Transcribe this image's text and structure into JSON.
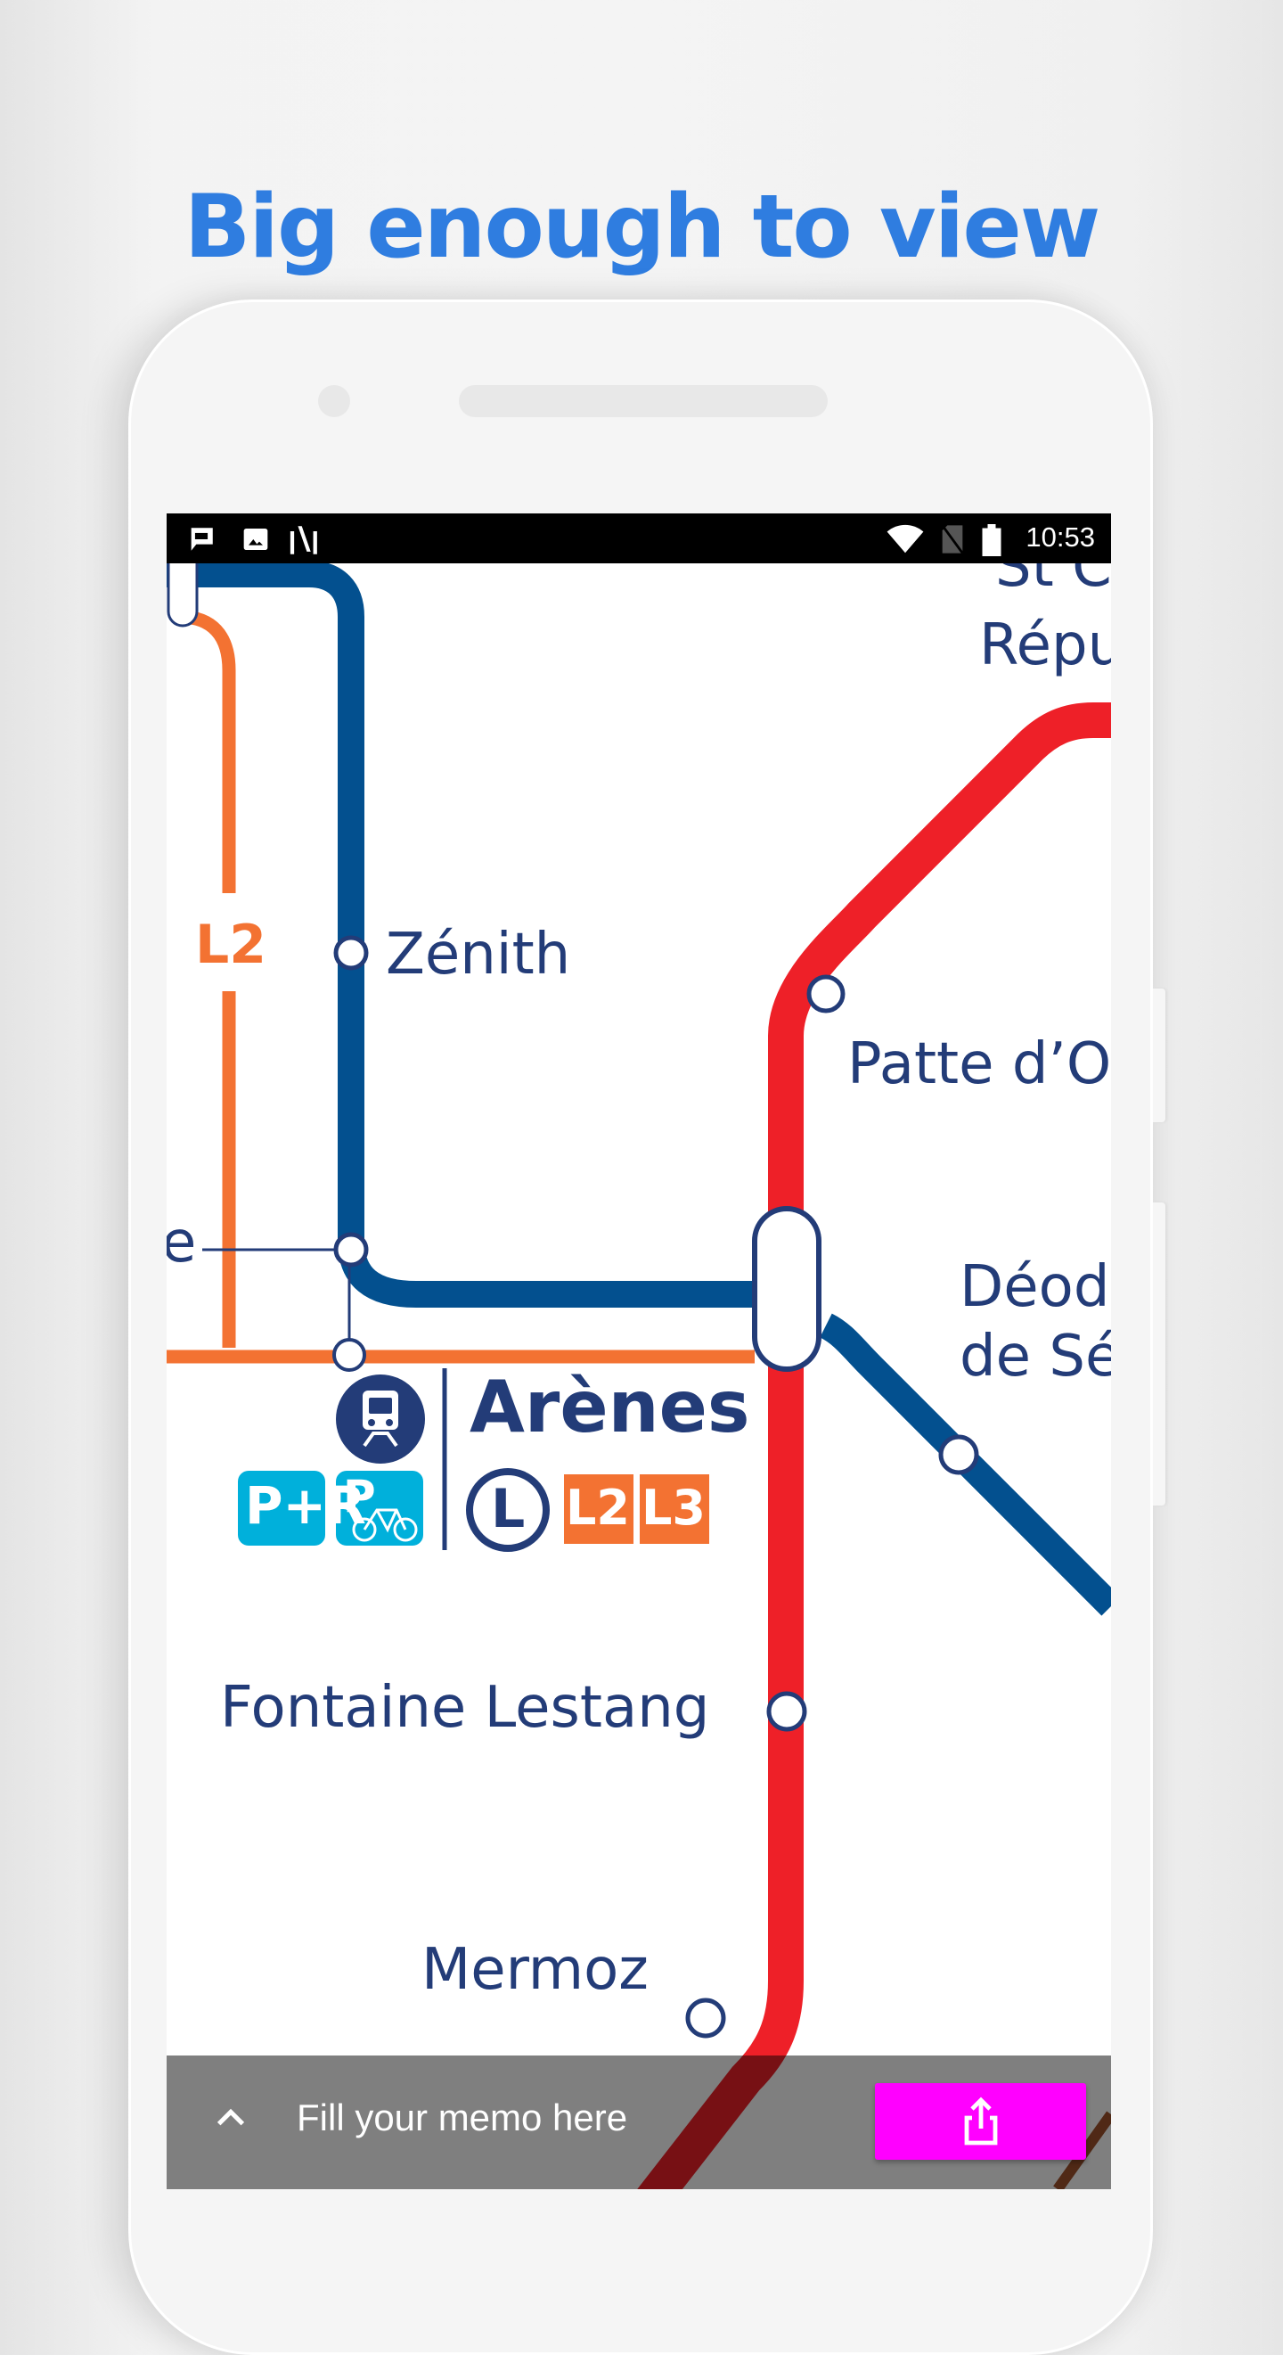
{
  "headline": "Big enough to view",
  "status_bar": {
    "left_icons": [
      "chat-notification-icon",
      "image-notification-icon",
      "app-notification-icon"
    ],
    "right_icons": [
      "wifi-icon",
      "no-sim-icon",
      "battery-icon"
    ],
    "time": "10:53"
  },
  "map": {
    "line_colors": {
      "metro_blue": "#03508f",
      "metro_red": "#ee2028",
      "tram_orange": "#f37232",
      "label_navy": "#233c78",
      "parking_cyan": "#00b0db"
    },
    "stations": {
      "st_charles_line1": "St C",
      "st_charles_line2": "Répu",
      "zenith": "Zénith",
      "patte_doie": "Patte d’O",
      "deodat_line1": "Déod",
      "deodat_line2": "de Sé",
      "partial_left": "e",
      "arenes": "Arènes",
      "fontaine_lestang": "Fontaine Lestang",
      "mermoz": "Mermoz"
    },
    "tram_line_label": "L2",
    "arenes_badges": {
      "park_ride": "P+R",
      "bike_parking": "P",
      "metro_letter": "L",
      "tram_lines": [
        "L2",
        "L3"
      ]
    }
  },
  "memo_bar": {
    "placeholder": "Fill your memo here",
    "share_button_color": "#ff00ff"
  }
}
